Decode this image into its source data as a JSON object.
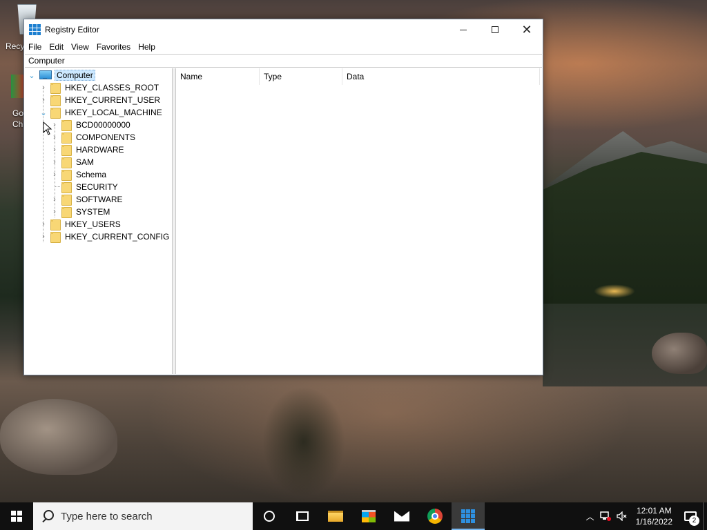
{
  "desktop": {
    "icons": [
      {
        "label": "Recy"
      },
      {
        "label_line1": "Go",
        "label_line2": "Ch"
      }
    ]
  },
  "window": {
    "title": "Registry Editor",
    "controls": {
      "minimize": "—",
      "maximize": "☐",
      "close": "✕"
    },
    "menu": [
      "File",
      "Edit",
      "View",
      "Favorites",
      "Help"
    ],
    "address": "Computer",
    "tree": {
      "root": "Computer",
      "hives": [
        "HKEY_CLASSES_ROOT",
        "HKEY_CURRENT_USER",
        "HKEY_LOCAL_MACHINE",
        "HKEY_USERS",
        "HKEY_CURRENT_CONFIG"
      ],
      "hklm_children": [
        "BCD00000000",
        "COMPONENTS",
        "HARDWARE",
        "SAM",
        "Schema",
        "SECURITY",
        "SOFTWARE",
        "SYSTEM"
      ],
      "expanded": "HKEY_LOCAL_MACHINE",
      "selected": "Computer"
    },
    "columns": [
      "Name",
      "Type",
      "Data"
    ]
  },
  "taskbar": {
    "search_placeholder": "Type here to search",
    "pinned": [
      "cortana-icon",
      "task-view-icon",
      "file-explorer-icon",
      "microsoft-store-icon",
      "mail-icon",
      "chrome-icon",
      "regedit-icon"
    ],
    "active_app": "regedit-icon",
    "clock": {
      "time": "12:01 AM",
      "date": "1/16/2022"
    },
    "notifications_count": "2"
  }
}
